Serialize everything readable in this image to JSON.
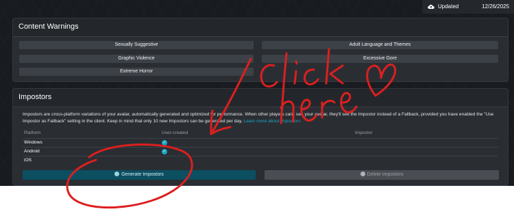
{
  "header": {
    "updated_label": "Updated",
    "updated_date": "12/26/2025",
    "icon": "cloud-upload-icon"
  },
  "content_warnings": {
    "title": "Content Warnings",
    "tags": [
      "Sexually Suggestive",
      "Adult Language and Themes",
      "Graphic Violence",
      "Excessive Gore",
      "Extreme Horror"
    ]
  },
  "impostors": {
    "title": "Impostors",
    "description": "Impostors are cross-platform variations of your avatar, automatically generated and optimized for performance. When other players can't see your avatar, they'll see the Impostor instead of a Fallback, provided you have enabled the \"Use Impostor as Fallback\" setting in the client. Keep in mind that only 10 new Impostors can be generated per day.",
    "learn_more": "Learn more about Impostors",
    "columns": [
      "Platform",
      "User-created",
      "Impostor"
    ],
    "rows": [
      {
        "platform": "Windows",
        "user_created": true
      },
      {
        "platform": "Android",
        "user_created": true
      },
      {
        "platform": "iOS",
        "user_created": false
      }
    ],
    "generate_label": "Generate Impostors",
    "delete_label": "Delete Impostors"
  },
  "annotation": {
    "text": "Click here",
    "color": "#dd1f1f"
  }
}
